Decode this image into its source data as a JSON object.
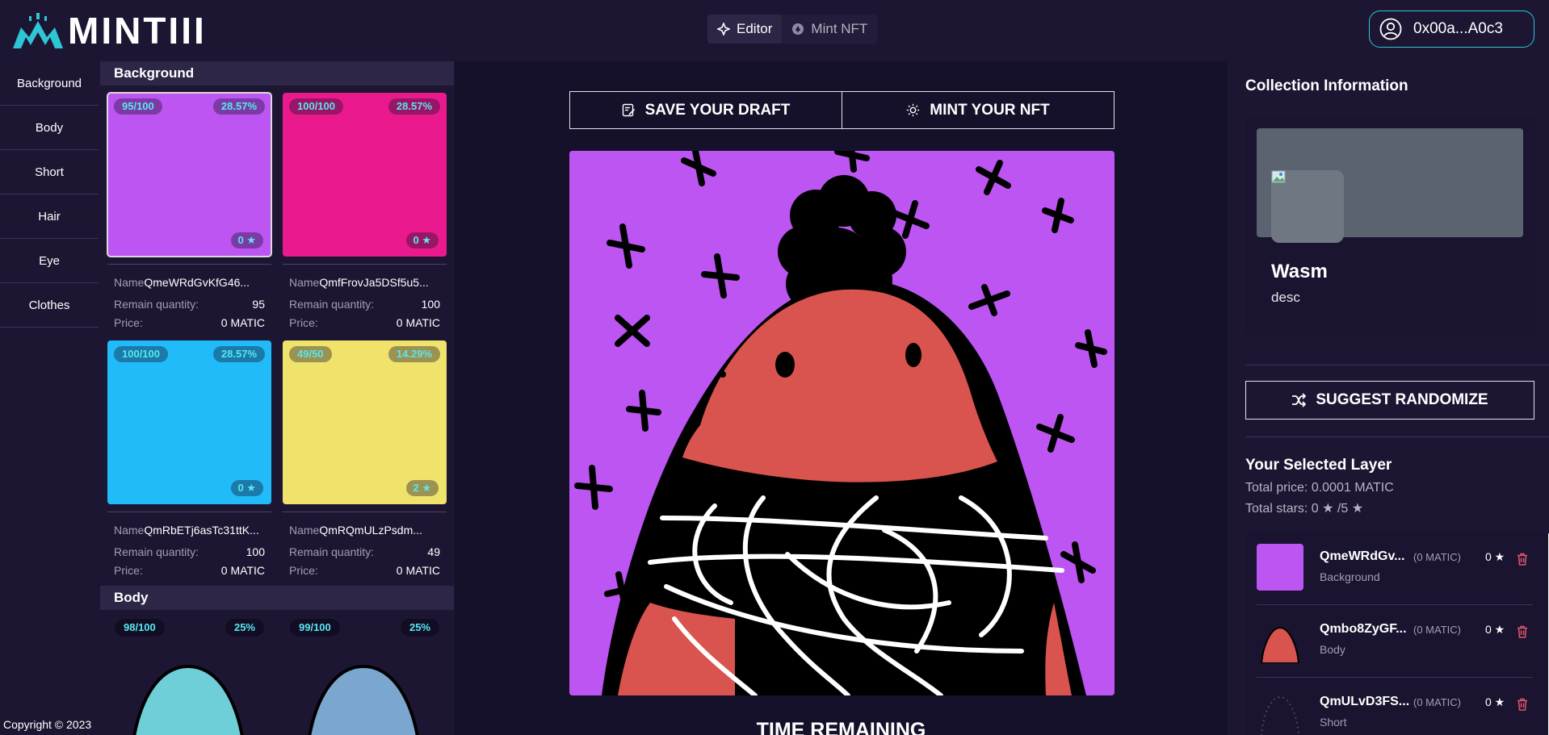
{
  "header": {
    "logo_text": "MINTIII",
    "mode_tabs": [
      {
        "label": "Editor",
        "active": true
      },
      {
        "label": "Mint NFT",
        "active": false
      }
    ],
    "wallet_address": "0x00a...A0c3"
  },
  "sidebar": {
    "items": [
      {
        "label": "Background"
      },
      {
        "label": "Body"
      },
      {
        "label": "Short"
      },
      {
        "label": "Hair"
      },
      {
        "label": "Eye"
      },
      {
        "label": "Clothes"
      }
    ],
    "copyright": "Copyright © 2023"
  },
  "layer_panel": {
    "background_section": {
      "title": "Background",
      "labels": {
        "name": "Name",
        "remain": "Remain quantity:",
        "price": "Price:"
      },
      "cards": [
        {
          "qty": "95/100",
          "pct": "28.57%",
          "stars": "0 ★",
          "name": "QmeWRdGvKfG46...",
          "remain": "95",
          "price": "0 MATIC",
          "color": "#bc55f2",
          "selected": true
        },
        {
          "qty": "100/100",
          "pct": "28.57%",
          "stars": "0 ★",
          "name": "QmfFrovJa5DSf5u5...",
          "remain": "100",
          "price": "0 MATIC",
          "color": "#ea1a8e",
          "selected": false
        },
        {
          "qty": "100/100",
          "pct": "28.57%",
          "stars": "0 ★",
          "name": "QmRbETj6asTc31ttK...",
          "remain": "100",
          "price": "0 MATIC",
          "color": "#20bbf8",
          "selected": false
        },
        {
          "qty": "49/50",
          "pct": "14.29%",
          "stars": "2 ★",
          "name": "QmRQmULzPsdm...",
          "remain": "49",
          "price": "0 MATIC",
          "color": "#efe36c",
          "selected": false
        }
      ]
    },
    "body_section": {
      "title": "Body",
      "cards": [
        {
          "qty": "98/100",
          "pct": "25%",
          "color": "#6fcfd9"
        },
        {
          "qty": "99/100",
          "pct": "25%",
          "color": "#7aa6cf"
        }
      ]
    }
  },
  "editor": {
    "save_label": "SAVE YOUR DRAFT",
    "mint_label": "MINT YOUR NFT",
    "time_remaining_label": "TIME REMAINING"
  },
  "collection": {
    "section_title": "Collection Information",
    "name": "Wasm",
    "description": "desc"
  },
  "selection": {
    "randomize_label": "SUGGEST RANDOMIZE",
    "title": "Your Selected Layer",
    "total_price": "Total price: 0.0001 MATIC",
    "total_stars": "Total stars: 0 ★ /5 ★",
    "items": [
      {
        "name": "QmeWRdGv...",
        "price": "(0 MATIC)",
        "stars": "0 ★",
        "type": "Background",
        "thumb_color": "#bc55f2"
      },
      {
        "name": "Qmbo8ZyGF...",
        "price": "(0 MATIC)",
        "stars": "0 ★",
        "type": "Body",
        "thumb_color": "#d9534f"
      },
      {
        "name": "QmULvD3FS...",
        "price": "(0 MATIC)",
        "stars": "0 ★",
        "type": "Short",
        "thumb_color": "#1a1430"
      }
    ]
  },
  "colors": {
    "accent": "#29c9d6",
    "pill_text": "#58e7f0",
    "page_bg": "#1d1633"
  }
}
